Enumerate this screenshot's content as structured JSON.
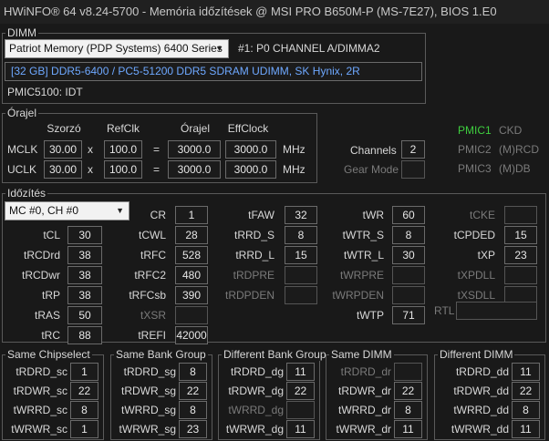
{
  "window": {
    "title": "HWiNFO® 64 v8.24-5700 - Memória időzítések @ MSI PRO B650M-P (MS-7E27), BIOS 1.E0"
  },
  "dimm": {
    "group_label": "DIMM",
    "module_select": "Patriot Memory (PDP Systems) 6400 Series",
    "slot_label": "#1: P0 CHANNEL A/DIMMA2",
    "info": "[32 GB] DDR5-6400 / PC5-51200 DDR5 SDRAM UDIMM, SK Hynix, 2R",
    "pmic": "PMIC5100: IDT"
  },
  "clock": {
    "group_label": "Órajel",
    "headers": {
      "multiplier": "Szorzó",
      "refclk": "RefClk",
      "clock": "Órajel",
      "effclock": "EffClock"
    },
    "rows": [
      {
        "label": "MCLK",
        "mult": "30.00",
        "x": "x",
        "ref": "100.0",
        "eq": "=",
        "clk": "3000.0",
        "eff": "3000.0",
        "unit": "MHz"
      },
      {
        "label": "UCLK",
        "mult": "30.00",
        "x": "x",
        "ref": "100.0",
        "eq": "=",
        "clk": "3000.0",
        "eff": "3000.0",
        "unit": "MHz"
      }
    ],
    "channels_label": "Channels",
    "channels_value": "2",
    "gear_label": "Gear Mode",
    "gear_value": "",
    "pmic": [
      {
        "name": "PMIC1",
        "rail": "CKD",
        "active": true
      },
      {
        "name": "PMIC2",
        "rail": "(M)RCD",
        "active": false
      },
      {
        "name": "PMIC3",
        "rail": "(M)DB",
        "active": false
      }
    ]
  },
  "timing": {
    "group_label": "Időzítés",
    "channel_select": "MC #0, CH #0",
    "col1": [
      {
        "label": "tCL",
        "value": "30"
      },
      {
        "label": "tRCDrd",
        "value": "38"
      },
      {
        "label": "tRCDwr",
        "value": "38"
      },
      {
        "label": "tRP",
        "value": "38"
      },
      {
        "label": "tRAS",
        "value": "50"
      },
      {
        "label": "tRC",
        "value": "88"
      }
    ],
    "col2": [
      {
        "label": "CR",
        "value": "1",
        "dim": false
      },
      {
        "label": "tCWL",
        "value": "28",
        "dim": false
      },
      {
        "label": "tRFC",
        "value": "528",
        "dim": false
      },
      {
        "label": "tRFC2",
        "value": "480",
        "dim": false
      },
      {
        "label": "tRFCsb",
        "value": "390",
        "dim": false
      },
      {
        "label": "tXSR",
        "value": "",
        "dim": true
      },
      {
        "label": "tREFI",
        "value": "42000",
        "dim": false
      }
    ],
    "col3": [
      {
        "label": "tFAW",
        "value": "32",
        "dim": false
      },
      {
        "label": "tRRD_S",
        "value": "8",
        "dim": false
      },
      {
        "label": "tRRD_L",
        "value": "15",
        "dim": false
      },
      {
        "label": "tRDPRE",
        "value": "",
        "dim": true
      },
      {
        "label": "tRDPDEN",
        "value": "",
        "dim": true
      }
    ],
    "col4": [
      {
        "label": "tWR",
        "value": "60",
        "dim": false
      },
      {
        "label": "tWTR_S",
        "value": "8",
        "dim": false
      },
      {
        "label": "tWTR_L",
        "value": "30",
        "dim": false
      },
      {
        "label": "tWRPRE",
        "value": "",
        "dim": true
      },
      {
        "label": "tWRPDEN",
        "value": "",
        "dim": true
      },
      {
        "label": "tWTP",
        "value": "71",
        "dim": false
      }
    ],
    "col5": [
      {
        "label": "tCKE",
        "value": "",
        "dim": true
      },
      {
        "label": "tCPDED",
        "value": "15",
        "dim": false
      },
      {
        "label": "tXP",
        "value": "23",
        "dim": false
      },
      {
        "label": "tXPDLL",
        "value": "",
        "dim": true
      },
      {
        "label": "tXSDLL",
        "value": "",
        "dim": true
      }
    ],
    "rtl_label": "RTL",
    "rtl_value": ""
  },
  "groups": [
    {
      "title": "Same Chipselect",
      "rows": [
        {
          "label": "tRDRD_sc",
          "value": "1",
          "dim": false
        },
        {
          "label": "tRDWR_sc",
          "value": "22",
          "dim": false
        },
        {
          "label": "tWRRD_sc",
          "value": "8",
          "dim": false
        },
        {
          "label": "tWRWR_sc",
          "value": "1",
          "dim": false
        }
      ]
    },
    {
      "title": "Same Bank Group",
      "rows": [
        {
          "label": "tRDRD_sg",
          "value": "8",
          "dim": false
        },
        {
          "label": "tRDWR_sg",
          "value": "22",
          "dim": false
        },
        {
          "label": "tWRRD_sg",
          "value": "8",
          "dim": false
        },
        {
          "label": "tWRWR_sg",
          "value": "23",
          "dim": false
        }
      ]
    },
    {
      "title": "Different Bank Group",
      "rows": [
        {
          "label": "tRDRD_dg",
          "value": "11",
          "dim": false
        },
        {
          "label": "tRDWR_dg",
          "value": "22",
          "dim": false
        },
        {
          "label": "tWRRD_dg",
          "value": "",
          "dim": true
        },
        {
          "label": "tWRWR_dg",
          "value": "11",
          "dim": false
        }
      ]
    },
    {
      "title": "Same DIMM",
      "rows": [
        {
          "label": "tRDRD_dr",
          "value": "",
          "dim": true
        },
        {
          "label": "tRDWR_dr",
          "value": "22",
          "dim": false
        },
        {
          "label": "tWRRD_dr",
          "value": "8",
          "dim": false
        },
        {
          "label": "tWRWR_dr",
          "value": "11",
          "dim": false
        }
      ]
    },
    {
      "title": "Different DIMM",
      "rows": [
        {
          "label": "tRDRD_dd",
          "value": "11",
          "dim": false
        },
        {
          "label": "tRDWR_dd",
          "value": "22",
          "dim": false
        },
        {
          "label": "tWRRD_dd",
          "value": "8",
          "dim": false
        },
        {
          "label": "tWRWR_dd",
          "value": "11",
          "dim": false
        }
      ]
    }
  ]
}
